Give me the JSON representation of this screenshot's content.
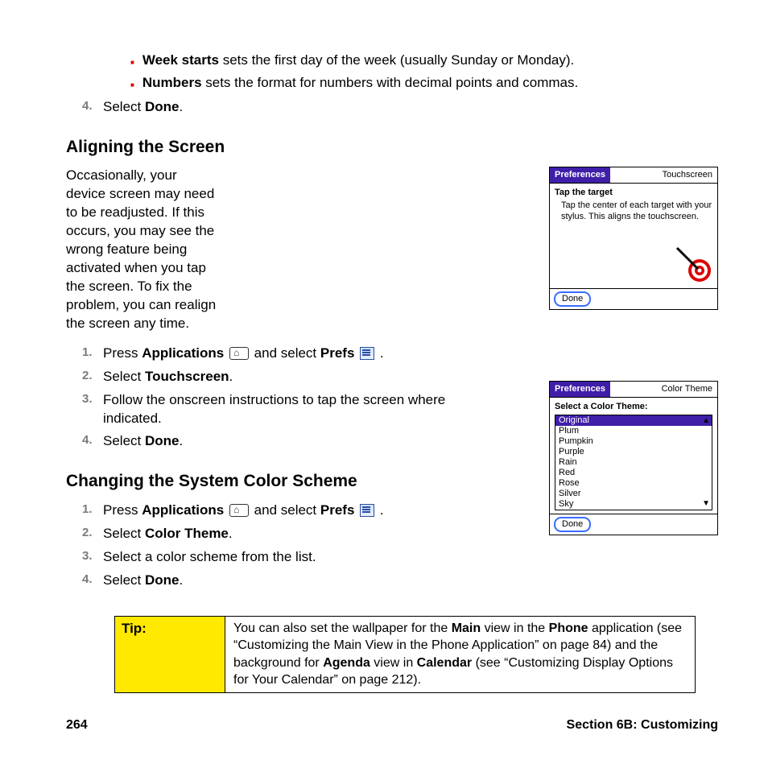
{
  "topBullets": [
    {
      "bold": "Week starts",
      "rest": " sets the first day of the week (usually Sunday or Monday)."
    },
    {
      "bold": "Numbers",
      "rest": " sets the format for numbers with decimal points and commas."
    }
  ],
  "step4a": {
    "num": "4.",
    "pre": "Select ",
    "b": "Done",
    "post": "."
  },
  "h1": "Aligning the Screen",
  "intro1": "Occasionally, your device screen may need to be readjusted. If this occurs, you may see the wrong feature being activated when you tap the screen. To fix the problem, you can realign the screen any time.",
  "alignSteps": [
    {
      "num": "1.",
      "pre": "Press ",
      "b1": "Applications",
      "mid": " ",
      "icon1": "app",
      "mid2": " and select ",
      "b2": "Prefs",
      "icon2": "prefs",
      "post": " ."
    },
    {
      "num": "2.",
      "pre": "Select ",
      "b1": "Touchscreen",
      "post": "."
    },
    {
      "num": "3.",
      "plain": "Follow the onscreen instructions to tap the screen where indicated."
    },
    {
      "num": "4.",
      "pre": "Select ",
      "b1": "Done",
      "post": "."
    }
  ],
  "h2": "Changing the System Color Scheme",
  "colorSteps": [
    {
      "num": "1.",
      "pre": "Press ",
      "b1": "Applications",
      "mid": " ",
      "icon1": "app",
      "mid2": " and select ",
      "b2": "Prefs",
      "icon2": "prefs",
      "post": " ."
    },
    {
      "num": "2.",
      "pre": "Select ",
      "b1": "Color Theme",
      "post": "."
    },
    {
      "num": "3.",
      "plain": "Select a color scheme from the list."
    },
    {
      "num": "4.",
      "pre": "Select ",
      "b1": "Done",
      "post": "."
    }
  ],
  "devA": {
    "titleL": "Preferences",
    "titleR": "Touchscreen",
    "sub": "Tap the target",
    "txt": "Tap the center of each target with your stylus. This aligns the touchscreen.",
    "done": "Done"
  },
  "devB": {
    "titleL": "Preferences",
    "titleR": "Color Theme",
    "sub": "Select a Color Theme:",
    "items": [
      "Original",
      "Plum",
      "Pumpkin",
      "Purple",
      "Rain",
      "Red",
      "Rose",
      "Silver",
      "Sky"
    ],
    "selected": 0,
    "done": "Done"
  },
  "tip": {
    "label": "Tip:",
    "t1": "You can also set the wallpaper for the ",
    "b1": "Main",
    "t2": " view in the ",
    "b2": "Phone",
    "t3": " application (see “Customizing the Main View in the Phone Application” on page 84) and the background for ",
    "b3": "Agenda",
    "t4": " view in ",
    "b4": "Calendar",
    "t5": " (see “Customizing Display Options for Your Calendar” on page 212)."
  },
  "footer": {
    "page": "264",
    "section": "Section 6B: Customizing"
  }
}
